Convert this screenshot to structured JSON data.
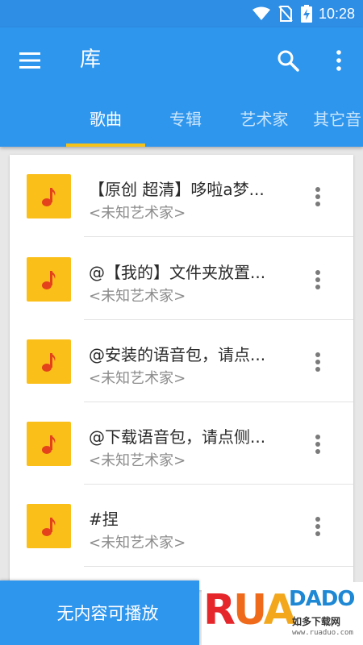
{
  "status_bar": {
    "time": "10:28",
    "icons": [
      "wifi-icon",
      "no-sim-icon",
      "battery-charging-icon"
    ]
  },
  "app_bar": {
    "title": "库",
    "icons": [
      "menu-icon",
      "search-icon",
      "more-vert-icon"
    ]
  },
  "tabs": [
    {
      "label": "歌曲",
      "active": true
    },
    {
      "label": "专辑",
      "active": false
    },
    {
      "label": "艺术家",
      "active": false
    },
    {
      "label": "其它音",
      "active": false
    }
  ],
  "colors": {
    "primary": "#2f96ee",
    "status_bar": "#2e8ee6",
    "tab_indicator": "#f5c21a",
    "album_art": "#fbbf1a",
    "note_icon": "#e3421c"
  },
  "songs": [
    {
      "title": "【原创 超清】哆啦a梦...",
      "artist": "<未知艺术家>"
    },
    {
      "title": "@【我的】文件夹放置...",
      "artist": "<未知艺术家>"
    },
    {
      "title": "@安装的语音包，请点...",
      "artist": "<未知艺术家>"
    },
    {
      "title": "@下载语音包，请点侧...",
      "artist": "<未知艺术家>"
    },
    {
      "title": "#捏",
      "artist": "<未知艺术家>"
    }
  ],
  "player": {
    "label": "无内容可播放"
  },
  "watermark": {
    "brand_left": "RUA",
    "brand_right": "DADO",
    "tagline": "如多下载网",
    "url": "www.ruaduo.com"
  }
}
